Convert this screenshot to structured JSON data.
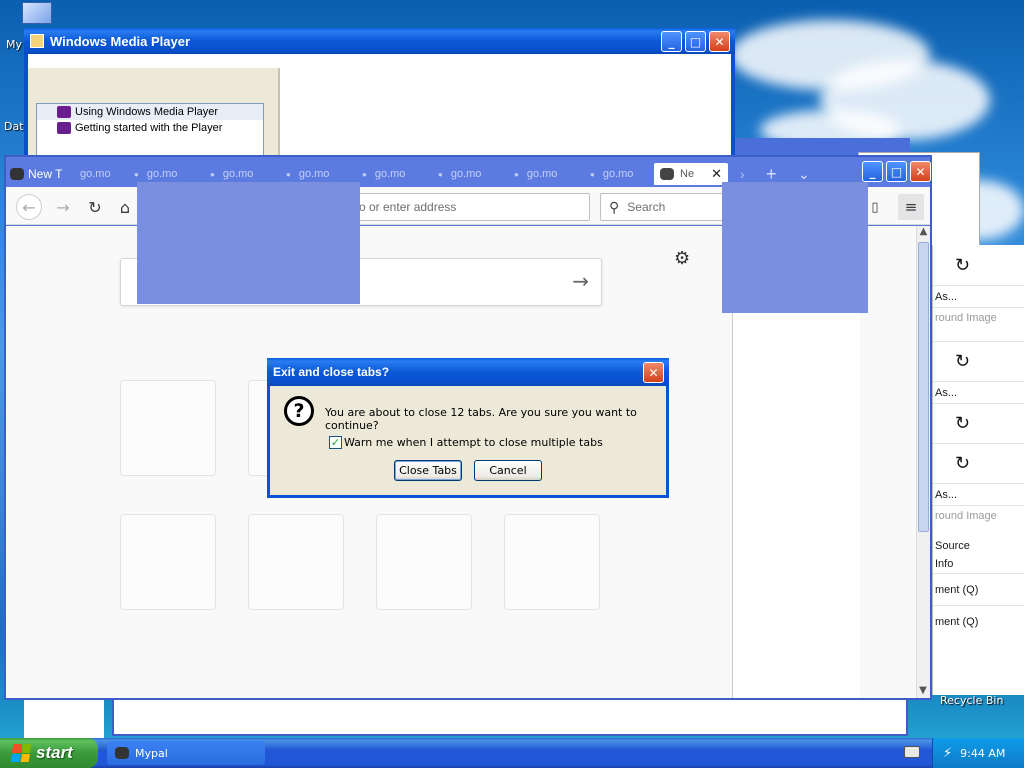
{
  "desktop": {
    "icons": [
      {
        "label": "My",
        "icon": "my-computer-icon"
      },
      {
        "label": "Data",
        "icon": "folder-icon"
      },
      {
        "label": "Recycle Bin",
        "icon": "recycle-bin-icon"
      }
    ]
  },
  "wmp": {
    "title": "Windows Media Player",
    "help_items": [
      "Using Windows Media Player",
      "Getting started with the Player"
    ]
  },
  "firefox": {
    "tabs": [
      "New T",
      "go.mo",
      "go.mo",
      "go.mo",
      "go.mo",
      "go.mo",
      "go.mo",
      "go.mo",
      "go.mo",
      "Ne"
    ],
    "url_placeholder": "Search or enter address",
    "url_visible": "o or enter address",
    "search_placeholder": "Search",
    "new_tab_button": "+",
    "tab_list_button": "⌄"
  },
  "context_menu": {
    "items": [
      "As...",
      "round Image",
      "As...",
      "As...",
      "round Image",
      "Source",
      "Info",
      "ment (Q)",
      "ment (Q)"
    ]
  },
  "dialog": {
    "title": "Exit and close tabs?",
    "message": "You are about to close 12 tabs. Are you sure you want to continue?",
    "checkbox_label": "Warn me when I attempt to close multiple tabs",
    "checkbox_checked": true,
    "close_tabs_label": "Close Tabs",
    "cancel_label": "Cancel"
  },
  "taskbar": {
    "start_label": "start",
    "task_label": "Mypal",
    "clock": "9:44 AM"
  },
  "colors": {
    "xp_blue": "#0a53d6",
    "overlay_blue": "#7b8fe0",
    "start_green": "#3a9a3a"
  }
}
